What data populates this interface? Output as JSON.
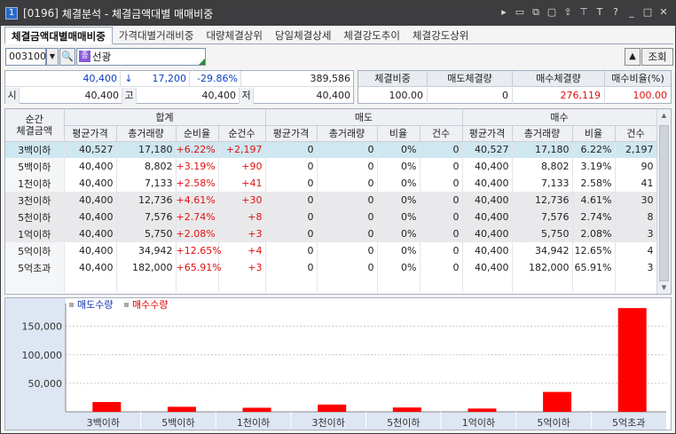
{
  "window": {
    "badge": "1",
    "code": "[0196]",
    "title": "체결분석 - 체결금액대별 매매비중",
    "icons": [
      "play-icon",
      "memo-icon",
      "window-link-icon",
      "copy-window-icon",
      "send-icon",
      "pin-icon",
      "text-size-icon",
      "help-icon",
      "minimize-icon",
      "maximize-icon",
      "close-icon"
    ],
    "icon_glyphs": [
      "▸",
      "▭",
      "⧉",
      "▢",
      "⇪",
      "⊤",
      "T",
      "?",
      "_",
      "□",
      "✕"
    ]
  },
  "tabs": [
    "체결금액대별매매비중",
    "가격대별거래비중",
    "대량체결상위",
    "당일체결상세",
    "체결강도추이",
    "체결강도상위"
  ],
  "toolbar": {
    "code": "003100",
    "jong_badge": "종",
    "name": "선광",
    "query_label": "조회",
    "up_label": "▲"
  },
  "quote": {
    "price": "40,400",
    "arrow": "↓",
    "change": "17,200",
    "rate": "-29.86%",
    "volume": "389,586",
    "open_label": "시",
    "open": "40,400",
    "high_label": "고",
    "high": "40,400",
    "low_label": "저",
    "low": "40,400"
  },
  "ratio": {
    "headers": [
      "체결비중",
      "매도체결량",
      "매수체결량",
      "매수비율(%)"
    ],
    "values": [
      "100.00",
      "0",
      "276,119",
      "100.00"
    ]
  },
  "grid": {
    "headers": {
      "rowlabel": "순간\n체결금액",
      "total": "합계",
      "sell": "매도",
      "buy": "매수",
      "sub": [
        "평균가격",
        "총거래량",
        "순비율",
        "순건수",
        "평균가격",
        "총거래량",
        "비율",
        "건수",
        "평균가격",
        "총거래량",
        "비율",
        "건수"
      ]
    },
    "rows": [
      {
        "label": "3백이하",
        "cells": [
          "40,527",
          "17,180",
          "+6.22%",
          "+2,197",
          "0",
          "0",
          "0%",
          "0",
          "40,527",
          "17,180",
          "6.22%",
          "2,197"
        ]
      },
      {
        "label": "5백이하",
        "cells": [
          "40,400",
          "8,802",
          "+3.19%",
          "+90",
          "0",
          "0",
          "0%",
          "0",
          "40,400",
          "8,802",
          "3.19%",
          "90"
        ]
      },
      {
        "label": "1천이하",
        "cells": [
          "40,400",
          "7,133",
          "+2.58%",
          "+41",
          "0",
          "0",
          "0%",
          "0",
          "40,400",
          "7,133",
          "2.58%",
          "41"
        ]
      },
      {
        "label": "3천이하",
        "cells": [
          "40,400",
          "12,736",
          "+4.61%",
          "+30",
          "0",
          "0",
          "0%",
          "0",
          "40,400",
          "12,736",
          "4.61%",
          "30"
        ]
      },
      {
        "label": "5천이하",
        "cells": [
          "40,400",
          "7,576",
          "+2.74%",
          "+8",
          "0",
          "0",
          "0%",
          "0",
          "40,400",
          "7,576",
          "2.74%",
          "8"
        ]
      },
      {
        "label": "1억이하",
        "cells": [
          "40,400",
          "5,750",
          "+2.08%",
          "+3",
          "0",
          "0",
          "0%",
          "0",
          "40,400",
          "5,750",
          "2.08%",
          "3"
        ]
      },
      {
        "label": "5억이하",
        "cells": [
          "40,400",
          "34,942",
          "+12.65%",
          "+4",
          "0",
          "0",
          "0%",
          "0",
          "40,400",
          "34,942",
          "12.65%",
          "4"
        ]
      },
      {
        "label": "5억초과",
        "cells": [
          "40,400",
          "182,000",
          "+65.91%",
          "+3",
          "0",
          "0",
          "0%",
          "0",
          "40,400",
          "182,000",
          "65.91%",
          "3"
        ]
      }
    ]
  },
  "colors": {
    "sell": "#1030b0",
    "buy": "#e00000",
    "price_down": "#1040c0",
    "positive": "#e01010"
  },
  "chart_data": {
    "type": "bar",
    "categories": [
      "3백이하",
      "5백이하",
      "1천이하",
      "3천이하",
      "5천이하",
      "1억이하",
      "5억이하",
      "5억초과"
    ],
    "series": [
      {
        "name": "매도수량",
        "values": [
          0,
          0,
          0,
          0,
          0,
          0,
          0,
          0
        ]
      },
      {
        "name": "매수수량",
        "values": [
          17180,
          8802,
          7133,
          12736,
          7576,
          5750,
          34942,
          182000
        ]
      }
    ],
    "yticks": [
      "150,000",
      "100,000",
      "50,000"
    ],
    "ylim": [
      0,
      190000
    ],
    "legend": "top-left"
  }
}
